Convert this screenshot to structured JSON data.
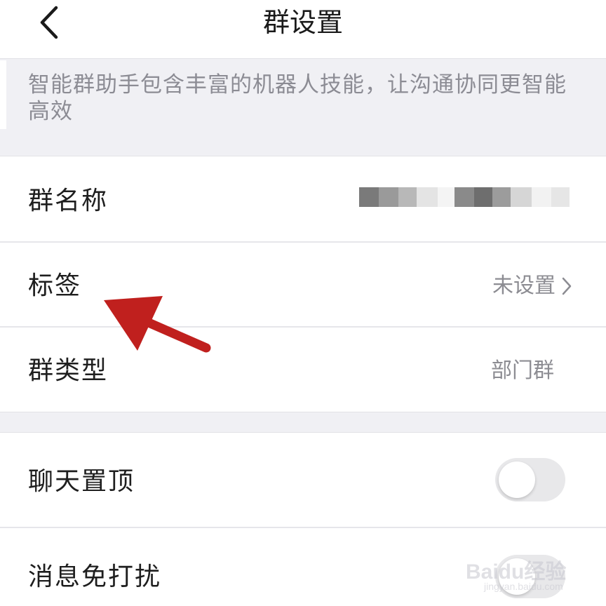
{
  "nav": {
    "title": "群设置",
    "back_icon": "chevron-left-icon"
  },
  "description": "智能群助手包含丰富的机器人技能，让沟通协同更智能高效",
  "group_info": {
    "rows": [
      {
        "label": "群名称",
        "value": ""
      },
      {
        "label": "标签",
        "value": "未设置"
      },
      {
        "label": "群类型",
        "value": "部门群"
      }
    ]
  },
  "chat_settings": {
    "rows": [
      {
        "label": "聊天置顶",
        "toggle_on": false
      },
      {
        "label": "消息免打扰",
        "toggle_on": false
      }
    ]
  },
  "overlay": {
    "arrow_color": "#c0201e"
  },
  "watermark": {
    "brand": "Baidu经验",
    "url": "jingyan.baidu.com"
  },
  "colors": {
    "background": "#f0f0f4",
    "card": "#ffffff",
    "secondary_text": "#8c8c92",
    "toggle_off": "#e8e8ea"
  }
}
